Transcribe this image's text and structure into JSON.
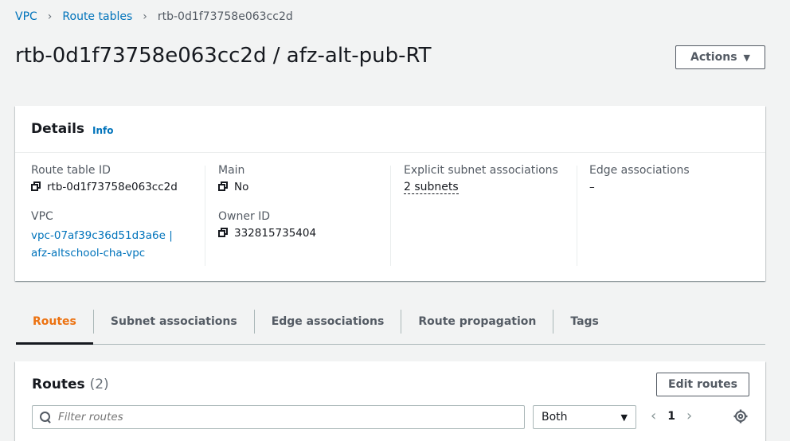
{
  "breadcrumb": {
    "items": [
      "VPC",
      "Route tables"
    ],
    "current": "rtb-0d1f73758e063cc2d"
  },
  "page": {
    "title": "rtb-0d1f73758e063cc2d / afz-alt-pub-RT",
    "actions_label": "Actions"
  },
  "details": {
    "title": "Details",
    "info": "Info",
    "route_table_id_label": "Route table ID",
    "route_table_id": "rtb-0d1f73758e063cc2d",
    "vpc_label": "VPC",
    "vpc_value": "vpc-07af39c36d51d3a6e | afz-altschool-cha-vpc",
    "main_label": "Main",
    "main_value": "No",
    "owner_label": "Owner ID",
    "owner_value": "332815735404",
    "explicit_label": "Explicit subnet associations",
    "explicit_value": "2 subnets",
    "edge_label": "Edge associations",
    "edge_value": "–"
  },
  "tabs": [
    "Routes",
    "Subnet associations",
    "Edge associations",
    "Route propagation",
    "Tags"
  ],
  "routes": {
    "title": "Routes",
    "count": "(2)",
    "edit_label": "Edit routes",
    "filter_placeholder": "Filter routes",
    "select_value": "Both",
    "page": "1"
  }
}
